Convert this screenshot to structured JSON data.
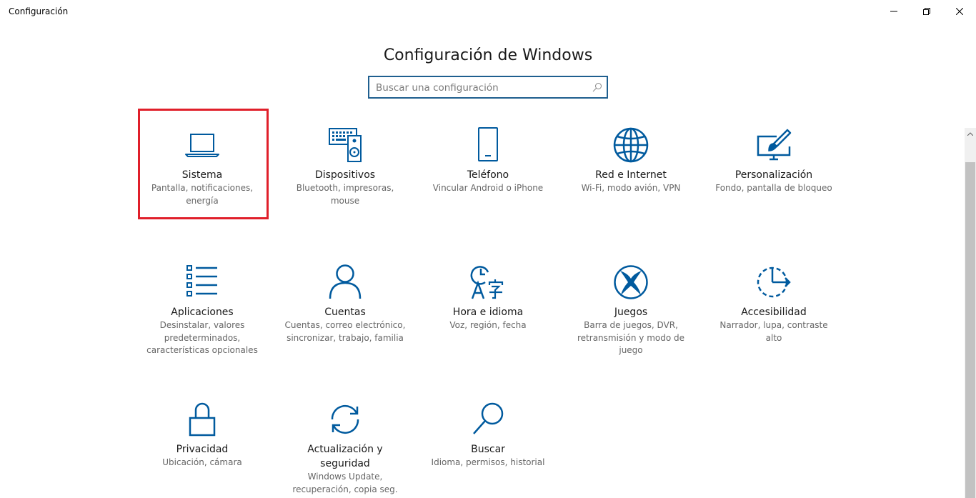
{
  "window": {
    "title": "Configuración"
  },
  "header": {
    "title": "Configuración de Windows"
  },
  "search": {
    "placeholder": "Buscar una configuración"
  },
  "colors": {
    "accent": "#005a9e",
    "highlight_border": "#e01f2a"
  },
  "tiles": [
    {
      "name": "Sistema",
      "desc_lines": [
        "Pantalla, notificaciones,",
        "energía"
      ],
      "icon": "laptop-icon"
    },
    {
      "name": "Dispositivos",
      "desc_lines": [
        "Bluetooth, impresoras,",
        "mouse"
      ],
      "icon": "devices-icon"
    },
    {
      "name": "Teléfono",
      "desc_lines": [
        "Vincular Android o iPhone"
      ],
      "icon": "phone-icon"
    },
    {
      "name": "Red e Internet",
      "desc_lines": [
        "Wi-Fi, modo avión, VPN"
      ],
      "icon": "globe-icon"
    },
    {
      "name": "Personalización",
      "desc_lines": [
        "Fondo, pantalla de bloqueo"
      ],
      "icon": "paintbrush-icon"
    },
    {
      "name": "Aplicaciones",
      "desc_lines": [
        "Desinstalar, valores",
        "predeterminados,",
        "características opcionales"
      ],
      "icon": "apps-list-icon"
    },
    {
      "name": "Cuentas",
      "desc_lines": [
        "Cuentas, correo electrónico,",
        "sincronizar, trabajo, familia"
      ],
      "icon": "person-icon"
    },
    {
      "name": "Hora e idioma",
      "desc_lines": [
        "Voz, región, fecha"
      ],
      "icon": "time-language-icon"
    },
    {
      "name": "Juegos",
      "desc_lines": [
        "Barra de juegos, DVR,",
        "retransmisión y modo de",
        "juego"
      ],
      "icon": "xbox-icon"
    },
    {
      "name": "Accesibilidad",
      "desc_lines": [
        "Narrador, lupa, contraste",
        "alto"
      ],
      "icon": "accessibility-icon"
    },
    {
      "name": "Privacidad",
      "name_lines": [
        "Privacidad"
      ],
      "desc_lines": [
        "Ubicación, cámara"
      ],
      "icon": "lock-icon"
    },
    {
      "name": "Actualización y seguridad",
      "name_lines": [
        "Actualización y",
        "seguridad"
      ],
      "desc_lines": [
        "Windows Update,",
        "recuperación, copia seg."
      ],
      "icon": "sync-icon"
    },
    {
      "name": "Buscar",
      "desc_lines": [
        "Idioma, permisos, historial"
      ],
      "icon": "magnifier-icon"
    }
  ]
}
